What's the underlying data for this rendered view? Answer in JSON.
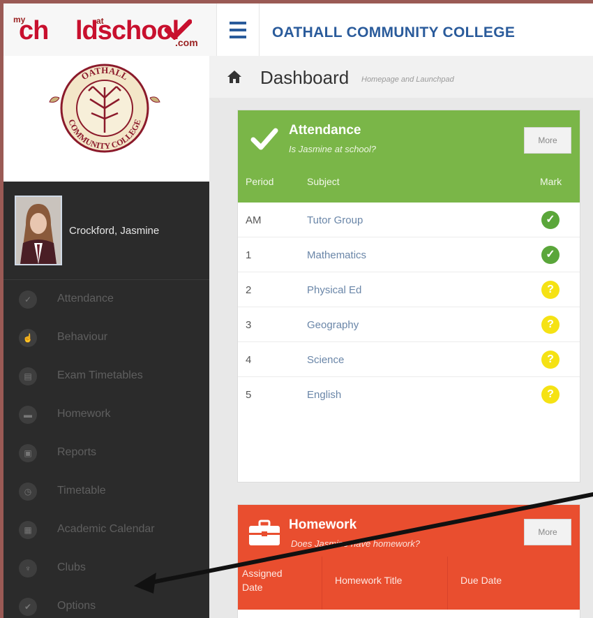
{
  "brand": {
    "logo_my": "my",
    "logo_ch": "ch",
    "logo_school": "ldschool",
    "logo_at": "at",
    "logo_com": ".com"
  },
  "header": {
    "school_name": "OATHALL COMMUNITY COLLEGE"
  },
  "crest": {
    "top_text": "OATHALL",
    "bottom_text": "COMMUNITY COLLEGE"
  },
  "profile": {
    "name": "Crockford, Jasmine"
  },
  "sidebar": {
    "items": [
      {
        "label": "Attendance"
      },
      {
        "label": "Behaviour"
      },
      {
        "label": "Exam Timetables"
      },
      {
        "label": "Homework"
      },
      {
        "label": "Reports"
      },
      {
        "label": "Timetable"
      },
      {
        "label": "Academic Calendar"
      },
      {
        "label": "Clubs"
      },
      {
        "label": "Options"
      }
    ]
  },
  "dashboard": {
    "title": "Dashboard",
    "subtitle": "Homepage and Launchpad"
  },
  "attendance": {
    "title": "Attendance",
    "subtitle": "Is Jasmine at school?",
    "more_label": "More",
    "columns": {
      "period": "Period",
      "subject": "Subject",
      "mark": "Mark"
    },
    "rows": [
      {
        "period": "AM",
        "subject": "Tutor Group",
        "mark": "present"
      },
      {
        "period": "1",
        "subject": "Mathematics",
        "mark": "present"
      },
      {
        "period": "2",
        "subject": "Physical Ed",
        "mark": "unknown"
      },
      {
        "period": "3",
        "subject": "Geography",
        "mark": "unknown"
      },
      {
        "period": "4",
        "subject": "Science",
        "mark": "unknown"
      },
      {
        "period": "5",
        "subject": "English",
        "mark": "unknown"
      }
    ],
    "mark_glyphs": {
      "present": "✓",
      "unknown": "?"
    }
  },
  "homework": {
    "title": "Homework",
    "subtitle": "Does Jasmine have homework?",
    "more_label": "More",
    "columns": {
      "assigned": "Assigned Date",
      "title": "Homework Title",
      "due": "Due Date"
    }
  },
  "colors": {
    "attendance_header": "#7ab648",
    "homework_header": "#e94e2f",
    "brand_red": "#c8102e",
    "link_blue": "#2a5b9b",
    "present": "#5aa63a",
    "unknown": "#f5e214"
  }
}
